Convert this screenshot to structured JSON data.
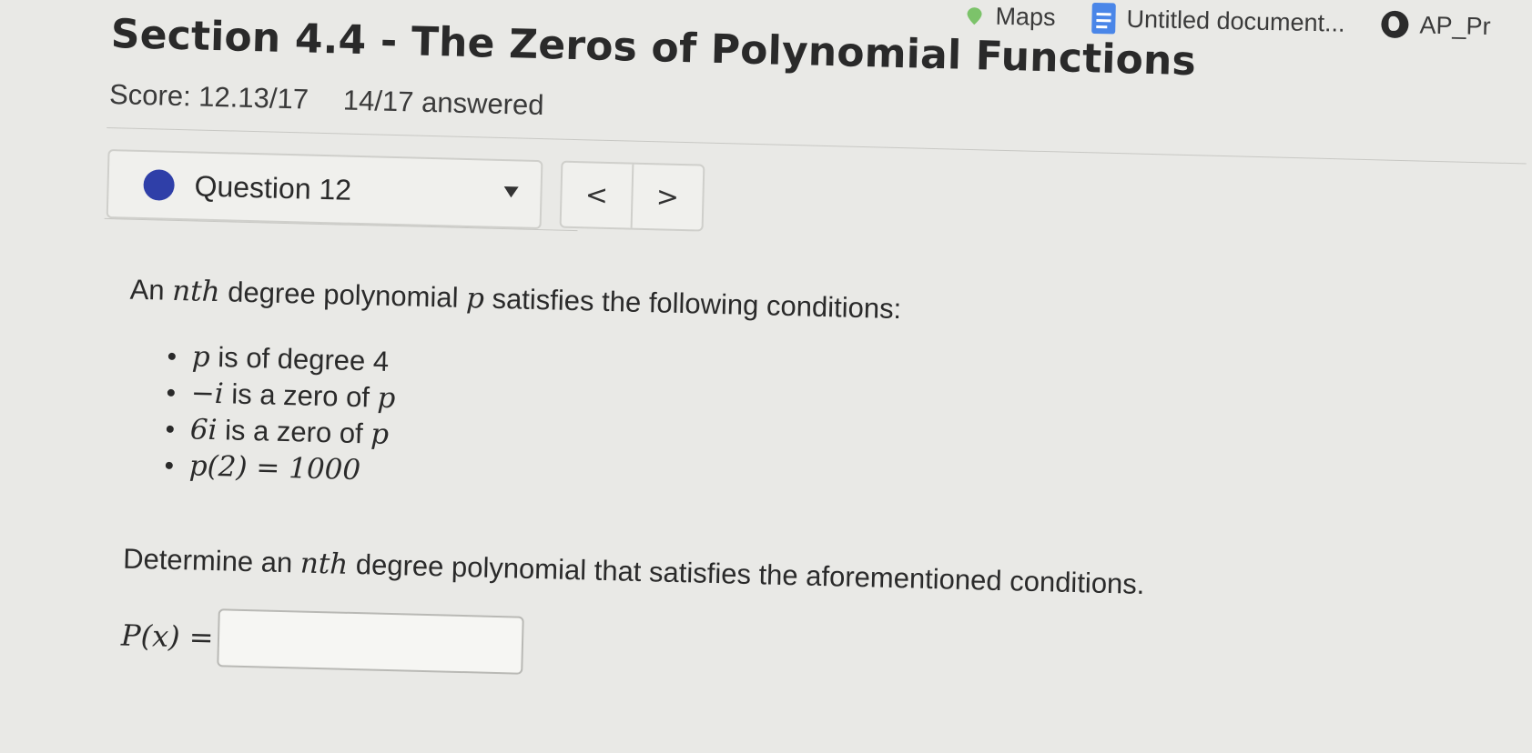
{
  "bookmarks": {
    "maps_label": "Maps",
    "doc_label": "Untitled document...",
    "ap_label": "AP_Pr",
    "icons": [
      "maps-icon",
      "docs-icon",
      "globe-icon"
    ]
  },
  "page": {
    "title": "Section 4.4 - The Zeros of Polynomial Functions",
    "score": "Score: 12.13/17",
    "answered": "14/17 answered"
  },
  "question_nav": {
    "selected": "Question 12",
    "status_color": "#2f3fa8",
    "prev": "<",
    "next": ">"
  },
  "problem": {
    "intro_pre": "An",
    "intro_var_n": "nth",
    "intro_mid": "degree polynomial",
    "intro_var_p": "p",
    "intro_post": "satisfies the following conditions:",
    "conditions": [
      {
        "math": "p",
        "text": "is of degree 4"
      },
      {
        "math": "−i",
        "text": "is a zero of",
        "math2": "p"
      },
      {
        "math": "6i",
        "text": "is a zero of",
        "math2": "p"
      },
      {
        "math": "p(2) = 1000",
        "text": ""
      }
    ],
    "determine_pre": "Determine an",
    "determine_var": "nth",
    "determine_post": "degree polynomial that satisfies the aforementioned conditions.",
    "answer_label": "P(x) =",
    "answer_value": ""
  }
}
